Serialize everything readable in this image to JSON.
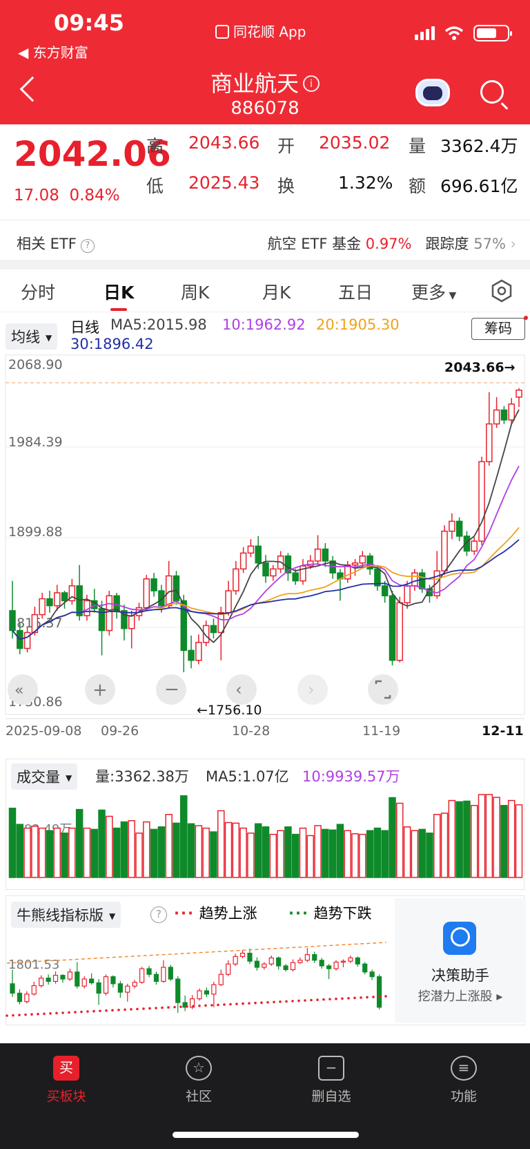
{
  "status": {
    "time": "09:45",
    "back_app": "东方财富",
    "app_name": "同花顺 App"
  },
  "header": {
    "title": "商业航天",
    "code": "886078"
  },
  "quote": {
    "price": "2042.06",
    "change": "17.08",
    "change_pct": "0.84%",
    "high_label": "高",
    "high": "2043.66",
    "open_label": "开",
    "open": "2035.02",
    "volume_label": "量",
    "volume": "3362.4万",
    "low_label": "低",
    "low": "2025.43",
    "turnover_label": "换",
    "turnover": "1.32%",
    "amount_label": "额",
    "amount": "696.61亿"
  },
  "etf": {
    "label": "相关 ETF",
    "fund": "航空 ETF 基金",
    "fund_pct": "0.97%",
    "track_label": "跟踪度",
    "track": "57%"
  },
  "tabs": [
    {
      "label": "分时"
    },
    {
      "label": "日K"
    },
    {
      "label": "周K"
    },
    {
      "label": "月K"
    },
    {
      "label": "五日"
    },
    {
      "label": "更多"
    }
  ],
  "ma_row": {
    "selector": "均线",
    "period": "日线",
    "ma5": "MA5:2015.98",
    "ma10": "10:1962.92",
    "ma20": "20:1905.30",
    "ma30": "30:1896.42",
    "chip_button": "筹码"
  },
  "price_axis": [
    "2068.90",
    "1984.39",
    "1899.88",
    "1815.37",
    "1730.86"
  ],
  "dates": [
    "2025-09-08",
    "09-26",
    "10-28",
    "11-19",
    "12-11"
  ],
  "annotations": {
    "high": "2043.66→",
    "low": "←1756.10"
  },
  "volume": {
    "selector": "成交量",
    "vol": "量:3362.38万",
    "ma5": "MA5:1.07亿",
    "ma10": "10:9939.57万",
    "axis": "6782.49万"
  },
  "indicator": {
    "selector": "牛熊线指标版",
    "up_label": "趋势上涨",
    "down_label": "趋势下跌",
    "axis": "1801.53"
  },
  "assistant": {
    "title": "决策助手",
    "subtitle": "挖潜力上涨股 ▸"
  },
  "tabbar": [
    {
      "label": "买板块",
      "icon_text": "买"
    },
    {
      "label": "社区"
    },
    {
      "label": "删自选"
    },
    {
      "label": "功能"
    }
  ],
  "colors": {
    "up": "#e8202c",
    "down": "#0f8a2a",
    "header": "#ee2b35",
    "ma5": "#444444",
    "ma10": "#b13ee6",
    "ma20": "#f0a21a",
    "ma30": "#1f2fa6"
  },
  "chart_data": {
    "type": "candlestick",
    "title": "日线",
    "x_range": [
      "2025-09-08",
      "12-11"
    ],
    "ylim": [
      1730.86,
      2068.9
    ],
    "candles": [
      [
        1820,
        1800,
        1850,
        1792
      ],
      [
        1800,
        1782,
        1808,
        1776
      ],
      [
        1782,
        1798,
        1804,
        1778
      ],
      [
        1798,
        1816,
        1824,
        1795
      ],
      [
        1816,
        1832,
        1838,
        1812
      ],
      [
        1832,
        1825,
        1840,
        1818
      ],
      [
        1825,
        1838,
        1846,
        1820
      ],
      [
        1838,
        1830,
        1840,
        1822
      ],
      [
        1830,
        1845,
        1852,
        1826
      ],
      [
        1845,
        1815,
        1866,
        1810
      ],
      [
        1815,
        1830,
        1836,
        1810
      ],
      [
        1830,
        1822,
        1842,
        1818
      ],
      [
        1822,
        1800,
        1830,
        1775
      ],
      [
        1800,
        1835,
        1840,
        1795
      ],
      [
        1835,
        1820,
        1838,
        1812
      ],
      [
        1820,
        1802,
        1826,
        1790
      ],
      [
        1802,
        1815,
        1820,
        1782
      ],
      [
        1815,
        1823,
        1828,
        1810
      ],
      [
        1823,
        1852,
        1856,
        1820
      ],
      [
        1852,
        1840,
        1858,
        1834
      ],
      [
        1840,
        1825,
        1846,
        1818
      ],
      [
        1825,
        1855,
        1870,
        1822
      ],
      [
        1855,
        1830,
        1860,
        1826
      ],
      [
        1830,
        1780,
        1836,
        1758
      ],
      [
        1780,
        1770,
        1795,
        1762
      ],
      [
        1770,
        1788,
        1796,
        1766
      ],
      [
        1788,
        1805,
        1810,
        1784
      ],
      [
        1805,
        1798,
        1812,
        1792
      ],
      [
        1798,
        1818,
        1824,
        1770
      ],
      [
        1818,
        1840,
        1850,
        1815
      ],
      [
        1840,
        1862,
        1870,
        1836
      ],
      [
        1862,
        1878,
        1884,
        1858
      ],
      [
        1878,
        1885,
        1892,
        1874
      ],
      [
        1885,
        1868,
        1895,
        1862
      ],
      [
        1868,
        1855,
        1876,
        1848
      ],
      [
        1855,
        1862,
        1866,
        1850
      ],
      [
        1862,
        1875,
        1880,
        1858
      ],
      [
        1875,
        1858,
        1878,
        1850
      ],
      [
        1858,
        1850,
        1862,
        1846
      ],
      [
        1850,
        1865,
        1872,
        1846
      ],
      [
        1865,
        1870,
        1876,
        1862
      ],
      [
        1870,
        1882,
        1896,
        1866
      ],
      [
        1882,
        1870,
        1888,
        1864
      ],
      [
        1870,
        1858,
        1875,
        1852
      ],
      [
        1858,
        1852,
        1862,
        1830
      ],
      [
        1852,
        1866,
        1870,
        1848
      ],
      [
        1866,
        1868,
        1872,
        1855
      ],
      [
        1868,
        1875,
        1880,
        1864
      ],
      [
        1875,
        1862,
        1878,
        1856
      ],
      [
        1862,
        1845,
        1866,
        1840
      ],
      [
        1845,
        1835,
        1850,
        1828
      ],
      [
        1835,
        1770,
        1840,
        1765
      ],
      [
        1770,
        1828,
        1834,
        1768
      ],
      [
        1828,
        1845,
        1850,
        1822
      ],
      [
        1845,
        1858,
        1862,
        1840
      ],
      [
        1858,
        1842,
        1862,
        1838
      ],
      [
        1842,
        1835,
        1846,
        1828
      ],
      [
        1835,
        1860,
        1880,
        1832
      ],
      [
        1860,
        1900,
        1906,
        1856
      ],
      [
        1900,
        1910,
        1918,
        1892
      ],
      [
        1910,
        1895,
        1914,
        1890
      ],
      [
        1895,
        1880,
        1900,
        1875
      ],
      [
        1880,
        1890,
        1894,
        1876
      ],
      [
        1890,
        1970,
        1975,
        1886
      ],
      [
        1970,
        2008,
        2040,
        1966
      ],
      [
        2008,
        2022,
        2035,
        2004
      ],
      [
        2022,
        2012,
        2026,
        2008
      ],
      [
        2012,
        2028,
        2034,
        2008
      ],
      [
        2035,
        2042,
        2044,
        2025
      ]
    ]
  }
}
